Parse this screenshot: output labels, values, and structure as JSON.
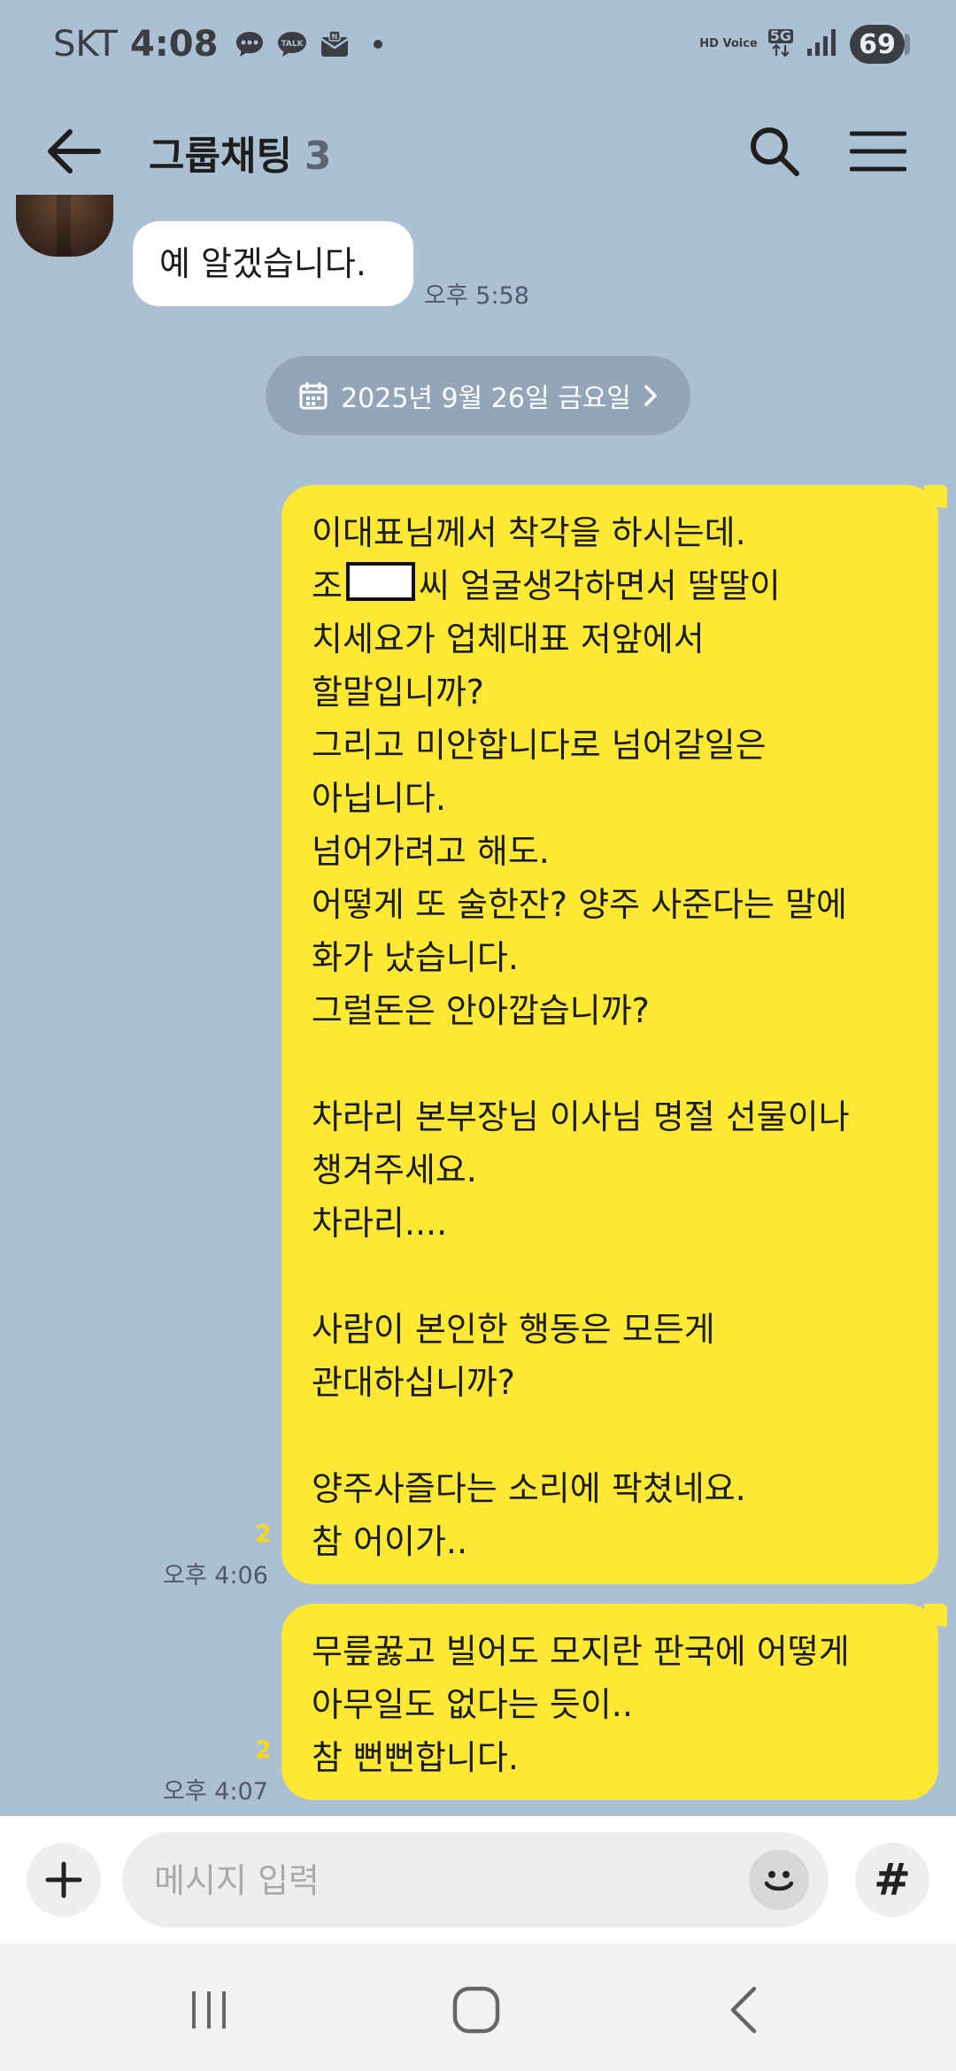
{
  "status_bar": {
    "carrier": "SKT",
    "time": "4:08",
    "notification_icons": [
      "chat-bubble-icon",
      "talk-icon",
      "naver-mail-icon"
    ],
    "network_label": "HD Voice",
    "network_type": "5G",
    "battery": "69"
  },
  "header": {
    "title": "그룹채팅",
    "member_count": "3"
  },
  "messages": [
    {
      "direction": "incoming",
      "text": "예 알겠습니다.",
      "time": "오후 5:58"
    },
    {
      "direction": "date",
      "text": "2025년 9월 26일 금요일"
    },
    {
      "direction": "outgoing",
      "lines": [
        "이대표님께서 착각을 하시는데.",
        "조",
        "씨 얼굴생각하면서 딸딸이",
        "치세요가 업체대표 저앞에서\n할말입니까?\n그리고 미안합니다로 넘어갈일은\n아닙니다.\n넘어가려고 해도.\n어떻게 또 술한잔? 양주 사준다는 말에\n화가 났습니다.\n그럴돈은 안아깝습니까?\n\n차라리 본부장님 이사님 명절 선물이나\n챙겨주세요.\n차라리....\n\n사람이 본인한 행동은 모든게\n관대하십니까?\n\n양주사즐다는 소리에 팍쳤네요.\n참 어이가.."
      ],
      "unread": "2",
      "time": "오후 4:06"
    },
    {
      "direction": "outgoing",
      "text": "무릎꿇고 빌어도 모지란 판국에 어떻게\n아무일도 없다는 듯이..\n참 뻔뻔합니다.",
      "unread": "2",
      "time": "오후 4:07"
    }
  ],
  "input_bar": {
    "placeholder": "메시지 입력",
    "hash_label": "#"
  },
  "colors": {
    "chat_background": "#abc0d2",
    "my_bubble": "#fde934",
    "other_bubble": "#ffffff",
    "unread_count": "#f7d81c"
  }
}
